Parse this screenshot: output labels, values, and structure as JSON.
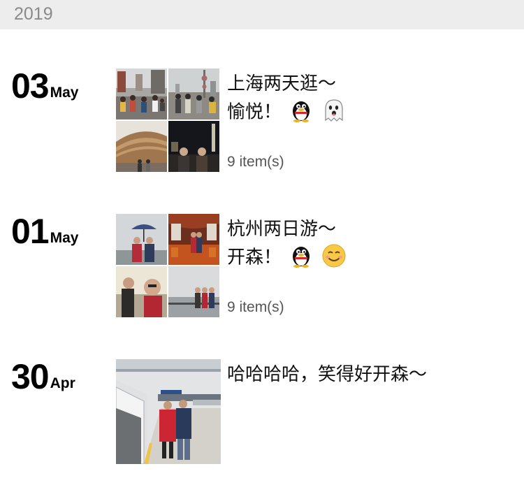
{
  "year": "2019",
  "posts": [
    {
      "day": "03",
      "month": "May",
      "caption_line1": "上海两天逛～",
      "caption_line2": "愉悦！",
      "emoji": [
        "penguin-icon",
        "ghost-icon"
      ],
      "count": "9 item(s)"
    },
    {
      "day": "01",
      "month": "May",
      "caption_line1": "杭州两日游～",
      "caption_line2": "开森！",
      "emoji": [
        "penguin-icon",
        "smile-icon"
      ],
      "count": "9 item(s)"
    },
    {
      "day": "30",
      "month": "Apr",
      "caption_line1": "哈哈哈哈，笑得好开森～"
    }
  ],
  "colors": {
    "header_bg": "#ededed",
    "year_text": "#8a8a8a",
    "count_text": "#555555"
  }
}
